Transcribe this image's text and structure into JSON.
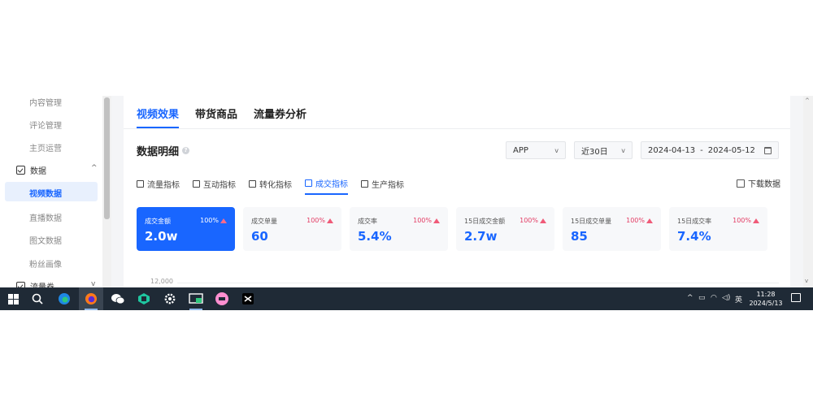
{
  "sidebar": {
    "items": [
      {
        "label": "内容管理"
      },
      {
        "label": "评论管理"
      },
      {
        "label": "主页运营"
      }
    ],
    "group_data": {
      "label": "数据",
      "icon": "data-icon"
    },
    "sub_items": [
      {
        "label": "视频数据",
        "active": true
      },
      {
        "label": "直播数据"
      },
      {
        "label": "图文数据"
      },
      {
        "label": "粉丝画像"
      }
    ],
    "group_traffic": {
      "label": "流量券",
      "icon": "ticket-icon"
    }
  },
  "main": {
    "tabs": [
      {
        "label": "视频效果",
        "active": true
      },
      {
        "label": "带货商品"
      },
      {
        "label": "流量券分析"
      }
    ],
    "section_title": "数据明细",
    "platform_select": "APP",
    "period_select": "近30日",
    "date_start": "2024-04-13",
    "date_sep": "-",
    "date_end": "2024-05-12",
    "metric_tabs": [
      {
        "label": "流量指标",
        "icon": "flow-icon"
      },
      {
        "label": "互动指标",
        "icon": "like-icon"
      },
      {
        "label": "转化指标",
        "icon": "funnel-icon"
      },
      {
        "label": "成交指标",
        "icon": "deal-icon",
        "active": true
      },
      {
        "label": "生产指标",
        "icon": "pen-icon"
      }
    ],
    "download_label": "下载数据",
    "cards": [
      {
        "label": "成交金额",
        "pct": "100%",
        "value": "2.0w",
        "active": true
      },
      {
        "label": "成交单量",
        "pct": "100%",
        "value": "60"
      },
      {
        "label": "成交率",
        "pct": "100%",
        "value": "5.4%"
      },
      {
        "label": "15日成交金额",
        "pct": "100%",
        "value": "2.7w"
      },
      {
        "label": "15日成交单量",
        "pct": "100%",
        "value": "85"
      },
      {
        "label": "15日成交率",
        "pct": "100%",
        "value": "7.4%"
      }
    ],
    "y_axis_top": "12,000"
  },
  "taskbar": {
    "lang": "英",
    "time": "11:28",
    "date": "2024/5/13"
  },
  "colors": {
    "accent": "#1966ff",
    "up_pink": "#f05a78",
    "taskbar": "#1f2a36"
  }
}
